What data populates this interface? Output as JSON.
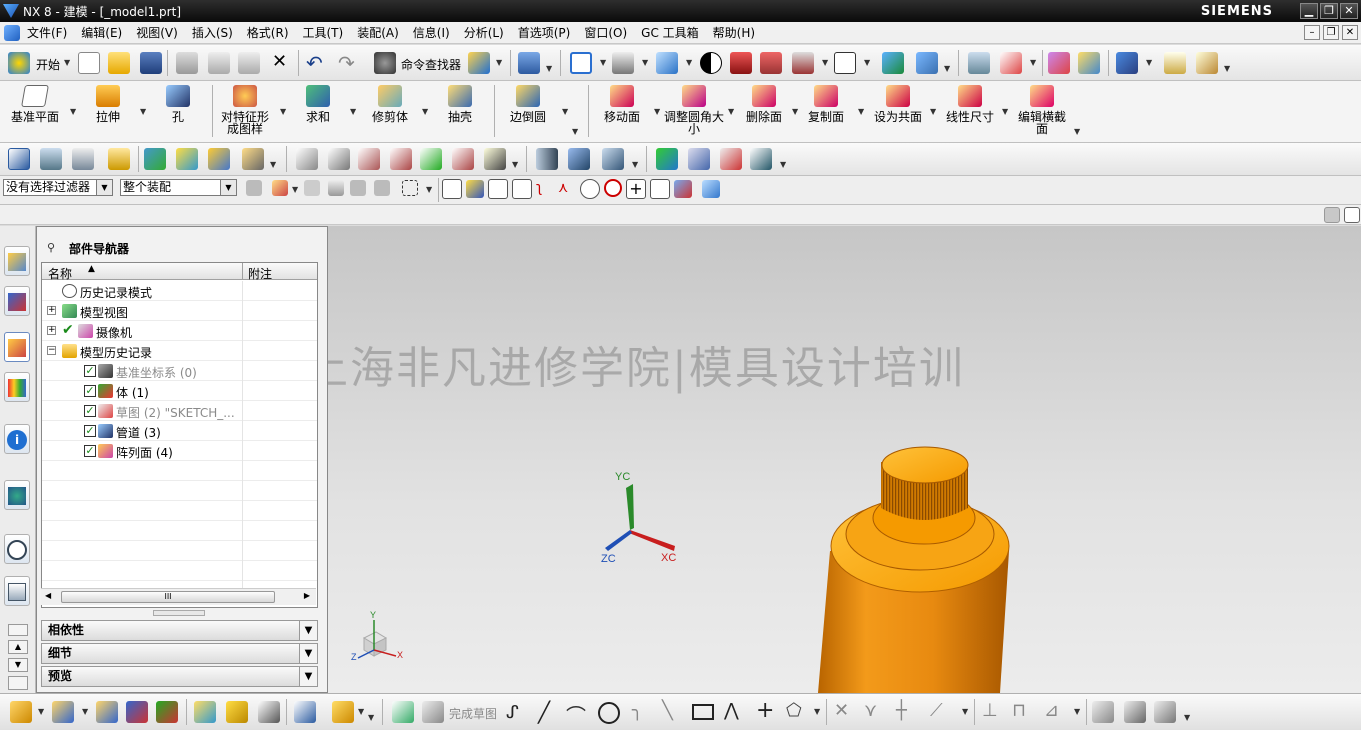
{
  "window": {
    "title": "NX 8 - 建模 - [_model1.prt]",
    "brand": "SIEMENS",
    "btn_min": "▁",
    "btn_restore": "❐",
    "btn_close": "✕"
  },
  "menu": [
    "文件(F)",
    "编辑(E)",
    "视图(V)",
    "插入(S)",
    "格式(R)",
    "工具(T)",
    "装配(A)",
    "信息(I)",
    "分析(L)",
    "首选项(P)",
    "窗口(O)",
    "GC 工具箱",
    "帮助(H)"
  ],
  "mdi": {
    "min": "–",
    "restore": "❐",
    "close": "✕"
  },
  "toolbar1": {
    "start_label": "开始",
    "command_finder_label": "命令查找器"
  },
  "feature_toolbar": [
    "基准平面",
    "拉伸",
    "孔",
    "对特征形成图样",
    "求和",
    "修剪体",
    "抽壳",
    "边倒圆",
    "移动面",
    "调整圆角大小",
    "删除面",
    "复制面",
    "设为共面",
    "线性尺寸",
    "编辑横截面"
  ],
  "selection_bar": {
    "filter": "没有选择过滤器",
    "scope": "整个装配"
  },
  "navigator": {
    "title": "部件导航器",
    "columns": {
      "name": "名称",
      "note": "附注"
    },
    "sort_arrow": "▲",
    "rows": [
      {
        "label": "历史记录模式"
      },
      {
        "label": "模型视图"
      },
      {
        "label": "摄像机"
      },
      {
        "label": "模型历史记录"
      },
      {
        "label": "基准坐标系 (0)"
      },
      {
        "label": "体 (1)"
      },
      {
        "label": "草图 (2) \"SKETCH_..."
      },
      {
        "label": "管道 (3)"
      },
      {
        "label": "阵列面 (4)"
      }
    ],
    "scroll_thumb": "III",
    "panels": [
      "相依性",
      "细节",
      "预览"
    ]
  },
  "viewport": {
    "watermark": "上海非凡进修学院|模具设计培训",
    "axes": {
      "y": "YC",
      "z": "ZC",
      "x": "XC"
    },
    "mini_axes": {
      "y": "Y",
      "z": "Z",
      "x": "X"
    }
  },
  "bottombar": {
    "finish_sketch": "完成草图"
  },
  "colors": {
    "titlebar": "#1a1a1a",
    "part_orange": "#f59a00",
    "tube_orange": "#e07d10",
    "check_green": "#1a8a1a"
  }
}
